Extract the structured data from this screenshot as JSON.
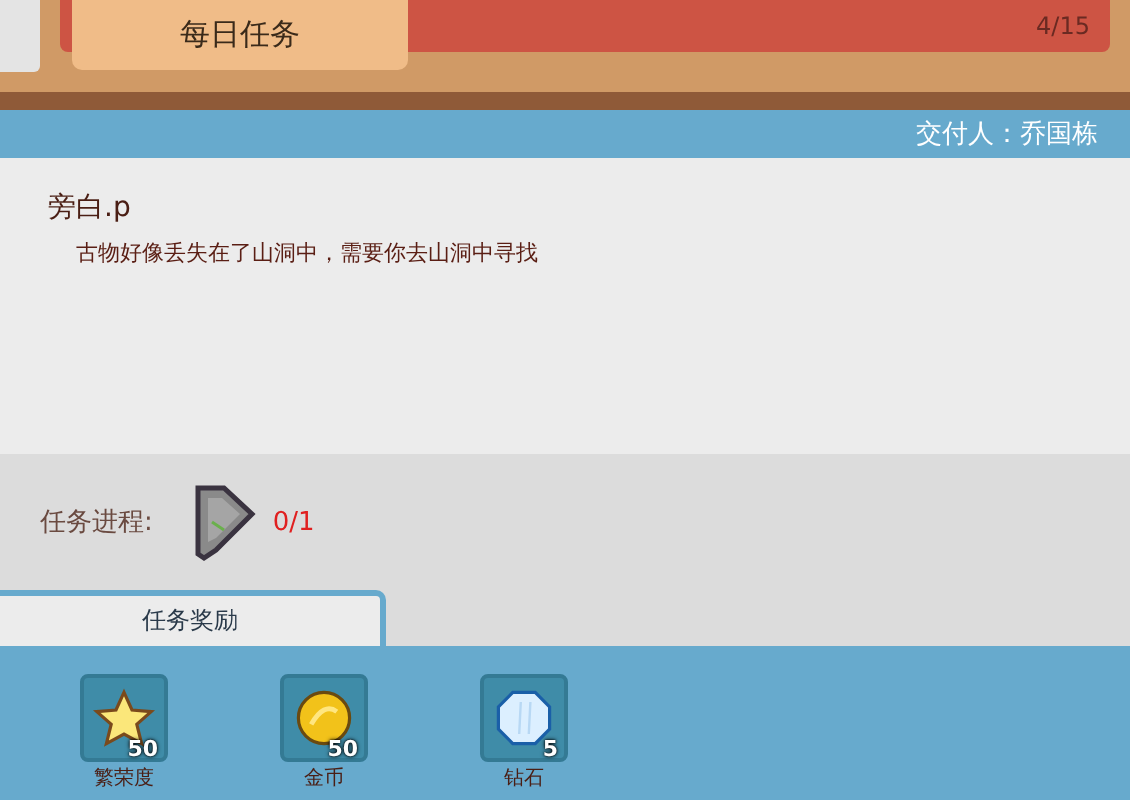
{
  "header": {
    "tab": {
      "label": "每日任务",
      "selected": true
    },
    "counter": "4/15"
  },
  "giver": "交付人：乔国栋",
  "dialog": {
    "speaker": "旁白.p",
    "text": "古物好像丢失在了山洞中，需要你去山洞中寻找"
  },
  "progress": {
    "label": "任务进程:",
    "count": "0/1"
  },
  "rewards_tab": {
    "label": "任务奖励"
  },
  "rewards": [
    {
      "kind": "star",
      "amount": "50",
      "name": "繁荣度"
    },
    {
      "kind": "coin",
      "amount": "50",
      "name": "金币"
    },
    {
      "kind": "diamond",
      "amount": "5",
      "name": "钻石"
    }
  ]
}
